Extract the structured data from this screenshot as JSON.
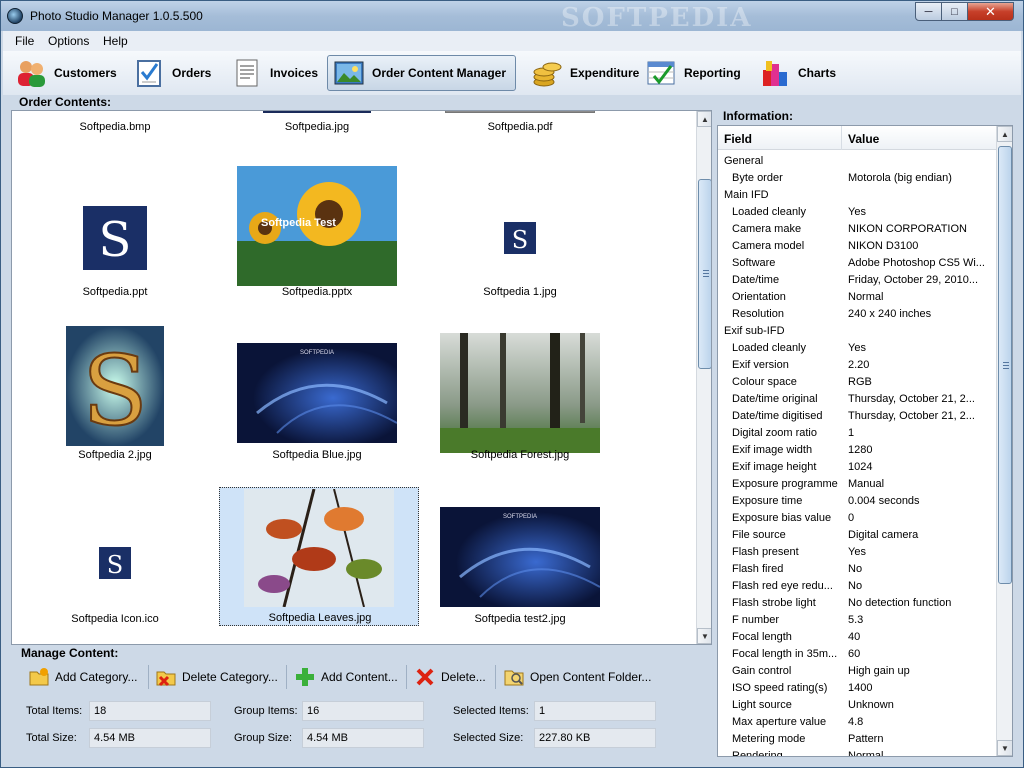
{
  "window": {
    "title": "Photo Studio Manager 1.0.5.500",
    "watermark": "SOFTPEDIA"
  },
  "menu": [
    "File",
    "Options",
    "Help"
  ],
  "toolbar": [
    {
      "label": "Customers",
      "icon": "customers-icon"
    },
    {
      "label": "Orders",
      "icon": "orders-icon"
    },
    {
      "label": "Invoices",
      "icon": "invoices-icon"
    },
    {
      "label": "Order Content Manager",
      "icon": "order-content-icon",
      "active": true
    },
    {
      "label": "Expenditure",
      "icon": "coins-icon"
    },
    {
      "label": "Reporting",
      "icon": "reporting-icon"
    },
    {
      "label": "Charts",
      "icon": "charts-icon"
    }
  ],
  "order_contents": {
    "label": "Order Contents:",
    "items": [
      {
        "name": "Softpedia.bmp",
        "kind": "partial"
      },
      {
        "name": "Softpedia.jpg",
        "kind": "partial-blue"
      },
      {
        "name": "Softpedia.pdf",
        "kind": "partial-gray"
      },
      {
        "name": "Softpedia.ppt",
        "kind": "s-logo-large"
      },
      {
        "name": "Softpedia.pptx",
        "kind": "sunflower",
        "overlay": "Softpedia Test"
      },
      {
        "name": "Softpedia 1.jpg",
        "kind": "s-logo-small"
      },
      {
        "name": "Softpedia 2.jpg",
        "kind": "s-art"
      },
      {
        "name": "Softpedia Blue.jpg",
        "kind": "blue",
        "overlay": "SOFTPEDIA"
      },
      {
        "name": "Softpedia Forest.jpg",
        "kind": "forest"
      },
      {
        "name": "Softpedia Icon.ico",
        "kind": "s-logo-small"
      },
      {
        "name": "Softpedia Leaves.jpg",
        "kind": "leaves",
        "selected": true
      },
      {
        "name": "Softpedia test2.jpg",
        "kind": "blue",
        "overlay": "SOFTPEDIA"
      }
    ]
  },
  "information": {
    "label": "Information:",
    "col_field": "Field",
    "col_value": "Value",
    "rows": [
      {
        "f": "General",
        "v": "",
        "group": true
      },
      {
        "f": "Byte order",
        "v": "Motorola (big endian)"
      },
      {
        "f": "Main IFD",
        "v": "",
        "group": true
      },
      {
        "f": "Loaded cleanly",
        "v": "Yes"
      },
      {
        "f": "Camera make",
        "v": "NIKON CORPORATION"
      },
      {
        "f": "Camera model",
        "v": "NIKON D3100"
      },
      {
        "f": "Software",
        "v": "Adobe Photoshop CS5 Wi..."
      },
      {
        "f": "Date/time",
        "v": "Friday, October 29, 2010..."
      },
      {
        "f": "Orientation",
        "v": "Normal"
      },
      {
        "f": "Resolution",
        "v": "240 x 240 inches"
      },
      {
        "f": "Exif sub-IFD",
        "v": "",
        "group": true
      },
      {
        "f": "Loaded cleanly",
        "v": "Yes"
      },
      {
        "f": "Exif version",
        "v": "2.20"
      },
      {
        "f": "Colour space",
        "v": "RGB"
      },
      {
        "f": "Date/time original",
        "v": "Thursday, October 21, 2..."
      },
      {
        "f": "Date/time digitised",
        "v": "Thursday, October 21, 2..."
      },
      {
        "f": "Digital zoom ratio",
        "v": "1"
      },
      {
        "f": "Exif image width",
        "v": "1280"
      },
      {
        "f": "Exif image height",
        "v": "1024"
      },
      {
        "f": "Exposure programme",
        "v": "Manual"
      },
      {
        "f": "Exposure time",
        "v": "0.004 seconds"
      },
      {
        "f": "Exposure bias value",
        "v": "0"
      },
      {
        "f": "File source",
        "v": "Digital camera"
      },
      {
        "f": "Flash present",
        "v": "Yes"
      },
      {
        "f": "Flash fired",
        "v": "No"
      },
      {
        "f": "Flash red eye redu...",
        "v": "No"
      },
      {
        "f": "Flash strobe light",
        "v": "No detection function"
      },
      {
        "f": "F number",
        "v": "5.3"
      },
      {
        "f": "Focal length",
        "v": "40"
      },
      {
        "f": "Focal length in 35m...",
        "v": "60"
      },
      {
        "f": "Gain control",
        "v": "High gain up"
      },
      {
        "f": "ISO speed rating(s)",
        "v": "1400"
      },
      {
        "f": "Light source",
        "v": "Unknown"
      },
      {
        "f": "Max aperture value",
        "v": "4.8"
      },
      {
        "f": "Metering mode",
        "v": "Pattern"
      },
      {
        "f": "Rendering",
        "v": "Normal"
      }
    ]
  },
  "manage": {
    "label": "Manage Content:",
    "buttons": [
      {
        "label": "Add Category...",
        "icon": "folder-add-icon"
      },
      {
        "label": "Delete Category...",
        "icon": "folder-delete-icon"
      },
      {
        "label": "Add Content...",
        "icon": "plus-icon"
      },
      {
        "label": "Delete...",
        "icon": "delete-x-icon"
      },
      {
        "label": "Open Content Folder...",
        "icon": "folder-open-icon"
      }
    ],
    "stats": {
      "total_items_label": "Total Items:",
      "total_items": "18",
      "group_items_label": "Group Items:",
      "group_items": "16",
      "selected_items_label": "Selected Items:",
      "selected_items": "1",
      "total_size_label": "Total Size:",
      "total_size": "4.54 MB",
      "group_size_label": "Group Size:",
      "group_size": "4.54 MB",
      "selected_size_label": "Selected Size:",
      "selected_size": "227.80 KB"
    }
  },
  "colors": {
    "accent": "#1f4f77",
    "logo_bg": "#1a2f66",
    "selection": "#cfe3f8"
  }
}
